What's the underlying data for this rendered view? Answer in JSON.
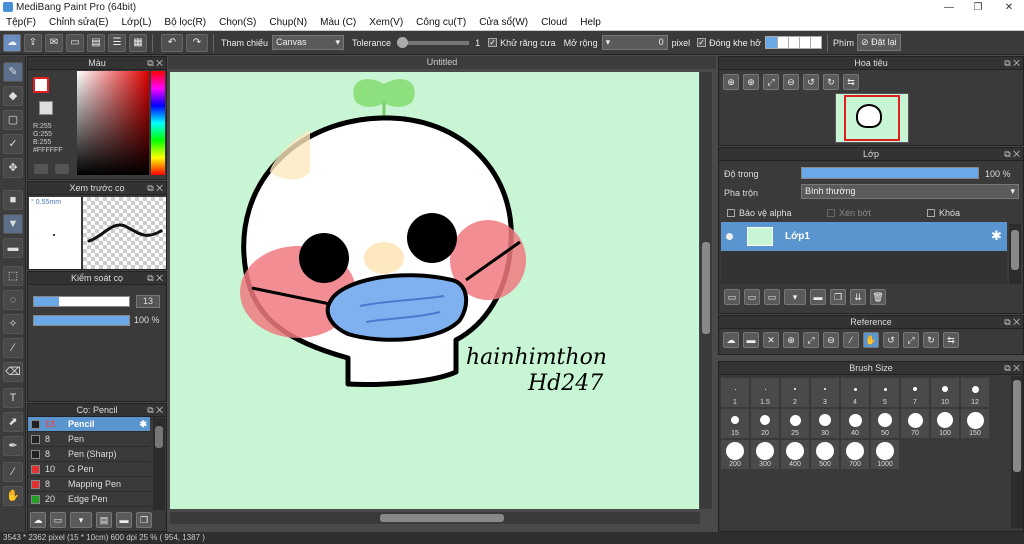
{
  "app": {
    "title": "MediBang Paint Pro (64bit)"
  },
  "menu": [
    "Tệp(F)",
    "Chỉnh sửa(E)",
    "Lớp(L)",
    "Bộ lọc(R)",
    "Chọn(S)",
    "Chụp(N)",
    "Màu (C)",
    "Xem(V)",
    "Công cụ(T)",
    "Cửa sổ(W)",
    "Cloud",
    "Help"
  ],
  "toolbar": {
    "reference_label": "Tham chiếu",
    "reference_value": "Canvas",
    "tolerance_label": "Tolerance",
    "tolerance_value": "1",
    "antialias_label": "Khử răng cưa",
    "expand_label": "Mở rộng",
    "expand_value": "0",
    "expand_unit": "pixel",
    "close_gap_label": "Đóng khe hở",
    "key_label": "Phím",
    "reset_label": "Đặt lại"
  },
  "color_panel": {
    "title": "Màu",
    "r": "R:255",
    "g": "G:255",
    "b": "B:255",
    "hex": "#FFFFFF"
  },
  "brush_preview": {
    "title": "Xem trước cọ",
    "size": "0.55mm"
  },
  "brush_control": {
    "title": "Kiểm soát cọ",
    "size_value": "13",
    "opacity_value": "100 %",
    "opacity": 1.0
  },
  "brush_list": {
    "title": "Cọ: Pencil",
    "items": [
      {
        "size": "13",
        "name": "Pencil",
        "color": "#222222",
        "selected": true
      },
      {
        "size": "8",
        "name": "Pen",
        "color": "#222222",
        "selected": false
      },
      {
        "size": "8",
        "name": "Pen (Sharp)",
        "color": "#222222",
        "selected": false
      },
      {
        "size": "10",
        "name": "G Pen",
        "color": "#e03030",
        "selected": false
      },
      {
        "size": "8",
        "name": "Mapping Pen",
        "color": "#e03030",
        "selected": false
      },
      {
        "size": "20",
        "name": "Edge Pen",
        "color": "#20a020",
        "selected": false
      }
    ]
  },
  "canvas": {
    "tab": "Untitled",
    "signature_line1": "hainhimthon",
    "signature_line2": "Hd247"
  },
  "navigator": {
    "title": "Hoa tiêu"
  },
  "layer_panel": {
    "title": "Lớp",
    "opacity_label": "Độ trong",
    "opacity_value": "100 %",
    "opacity": 1.0,
    "blend_label": "Pha trộn",
    "blend_value": "Bình thường",
    "protect_alpha": "Bảo vệ alpha",
    "clipping": "Xén bớt",
    "lock": "Khóa",
    "layer_name": "Lớp1"
  },
  "reference_panel": {
    "title": "Reference"
  },
  "brush_size_panel": {
    "title": "Brush Size",
    "sizes": [
      "1",
      "1.5",
      "2",
      "3",
      "4",
      "5",
      "7",
      "10",
      "12",
      "15",
      "20",
      "25",
      "30",
      "40",
      "50",
      "70",
      "100",
      "150",
      "200",
      "300",
      "400",
      "500",
      "700",
      "1000"
    ]
  },
  "status": {
    "text": "3543 * 2362 pixel   (15 * 10cm)   600 dpi   25 %   ( 954, 1387 )"
  }
}
